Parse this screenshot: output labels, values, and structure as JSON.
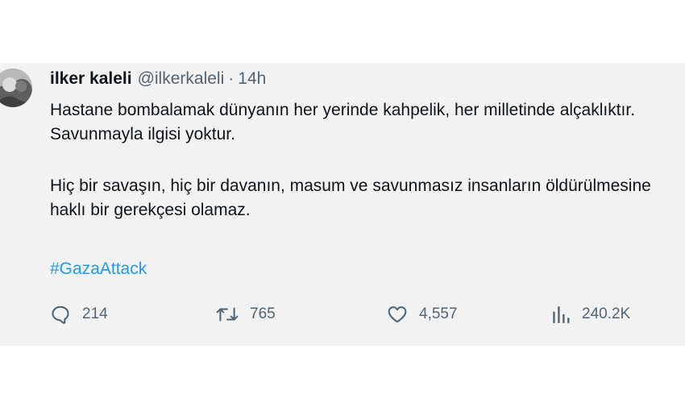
{
  "tweet": {
    "display_name": "ilker kaleli",
    "handle": "@ilkerkaleli",
    "separator": "·",
    "time": "14h",
    "paragraph_1": "Hastane bombalamak dünyanın her yerinde kahpelik, her milletinde alçaklıktır. Savunmayla ilgisi yoktur.",
    "paragraph_2": "Hiç bir savaşın, hiç bir davanın, masum ve savunmasız insanların öldürülmesine haklı bir gerekçesi olamaz.",
    "hashtag": "#GazaAttack"
  },
  "actions": {
    "replies": "214",
    "retweets": "765",
    "likes": "4,557",
    "views": "240.2K"
  },
  "colors": {
    "card_background": "#f2f2f2",
    "text": "#0f1419",
    "secondary_text": "#536471",
    "link": "#1d9bf0"
  },
  "icons": {
    "reply": "speech-bubble",
    "retweet": "retweet-arrows",
    "like": "heart",
    "views": "bar-chart"
  }
}
